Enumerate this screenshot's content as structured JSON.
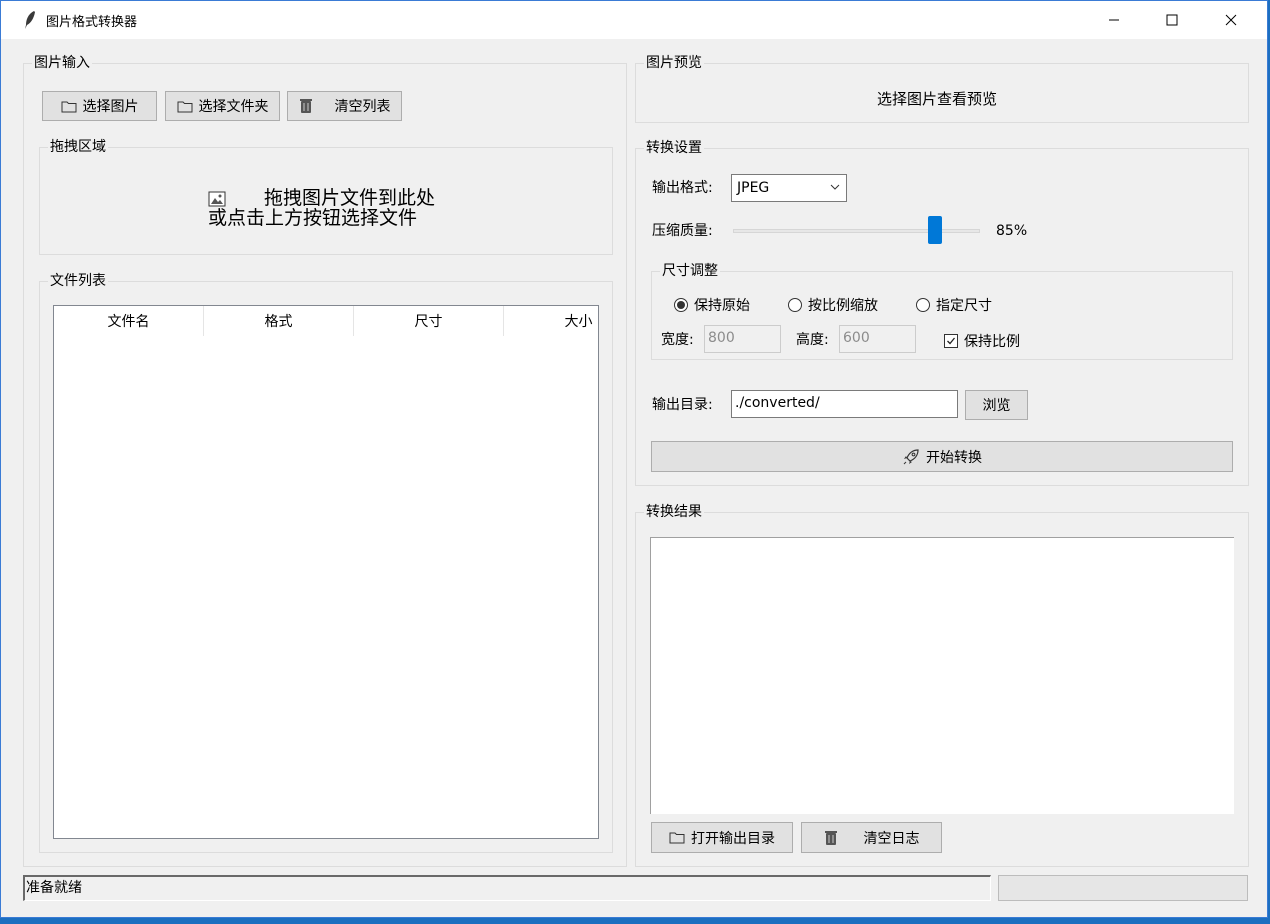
{
  "window": {
    "title": "图片格式转换器"
  },
  "input_group": {
    "title": "图片输入",
    "buttons": {
      "select_images": "选择图片",
      "select_folder": "选择文件夹",
      "clear_list": "清空列表"
    },
    "drop_zone": {
      "title": "拖拽区域",
      "line1": "拖拽图片文件到此处",
      "line2": "或点击上方按钮选择文件"
    }
  },
  "file_list": {
    "title": "文件列表",
    "columns": [
      "文件名",
      "格式",
      "尺寸",
      "大小"
    ],
    "rows": []
  },
  "preview": {
    "title": "图片预览",
    "placeholder": "选择图片查看预览"
  },
  "settings": {
    "title": "转换设置",
    "format_label": "输出格式:",
    "format_value": "JPEG",
    "quality_label": "压缩质量:",
    "quality_value": "85%",
    "quality_level": 85,
    "resize": {
      "title": "尺寸调整",
      "options": [
        "保持原始",
        "按比例缩放",
        "指定尺寸"
      ],
      "selected": "保持原始",
      "width_label": "宽度:",
      "width_value": "800",
      "height_label": "高度:",
      "height_value": "600",
      "keep_ratio_label": "保持比例",
      "keep_ratio_checked": true
    },
    "output_dir_label": "输出目录:",
    "output_dir_value": "./converted/",
    "browse_label": "浏览",
    "start_label": "开始转换"
  },
  "results": {
    "title": "转换结果",
    "open_dir_label": "打开输出目录",
    "clear_log_label": "清空日志"
  },
  "status": {
    "text": "准备就绪"
  },
  "colors": {
    "accent": "#0078d7",
    "window_bg": "#f0f0f0"
  }
}
